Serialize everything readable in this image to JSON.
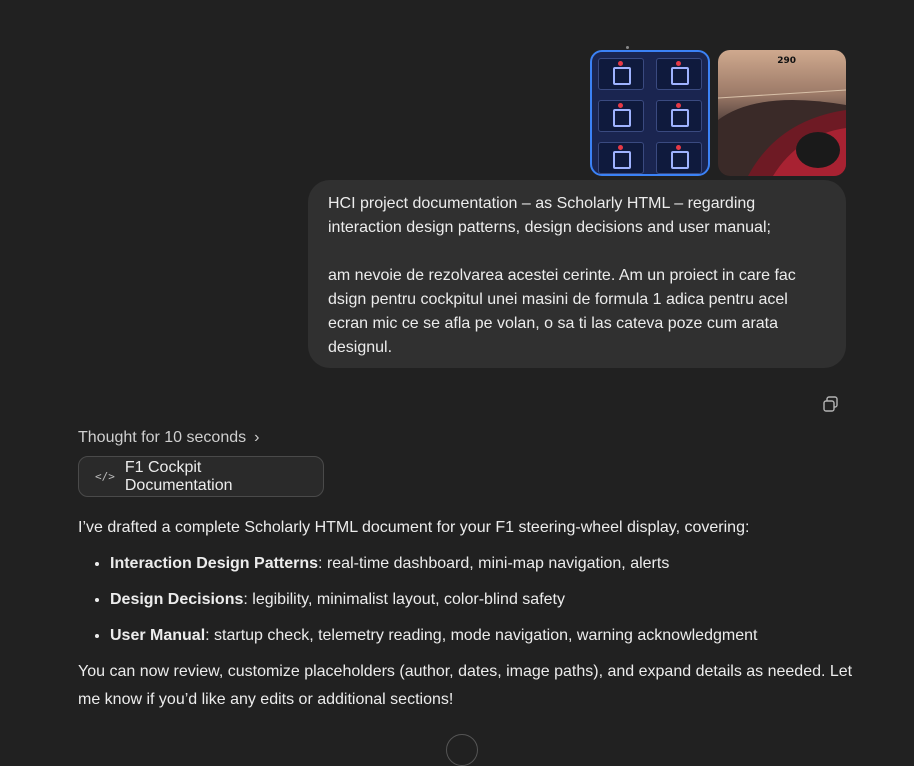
{
  "user_message": {
    "attachments": [
      {
        "icon": "dashboard-screens-image"
      },
      {
        "icon": "race-car-cockpit-image",
        "speed_text": "290"
      }
    ],
    "line1": " HCI project documentation – as Scholarly HTML – regarding",
    "line2": "interaction design patterns, design decisions and user manual;",
    "line3": "am nevoie de rezolvarea acestei cerinte. Am un proiect in care fac",
    "line4": "dsign pentru cockpitul unei masini de formula 1 adica pentru acel",
    "line5": "ecran mic ce se afla pe volan, o sa ti las cateva poze cum arata",
    "line6": "designul."
  },
  "assistant": {
    "thought_label": "Thought for 10 seconds",
    "doc_card_label": "F1 Cockpit Documentation",
    "intro": "I’ve drafted a complete Scholarly HTML document for your F1 steering-wheel display, covering:",
    "bullets": [
      {
        "title": "Interaction Design Patterns",
        "text": ": real-time dashboard, mini-map navigation, alerts"
      },
      {
        "title": "Design Decisions",
        "text": ": legibility, minimalist layout, color-blind safety"
      },
      {
        "title": "User Manual",
        "text": ": startup check, telemetry reading, mode navigation, warning acknowledgment"
      }
    ],
    "closing": "You can now review, customize placeholders (author, dates, image paths), and expand details as needed. Let me know if you’d like any edits or additional sections!"
  }
}
